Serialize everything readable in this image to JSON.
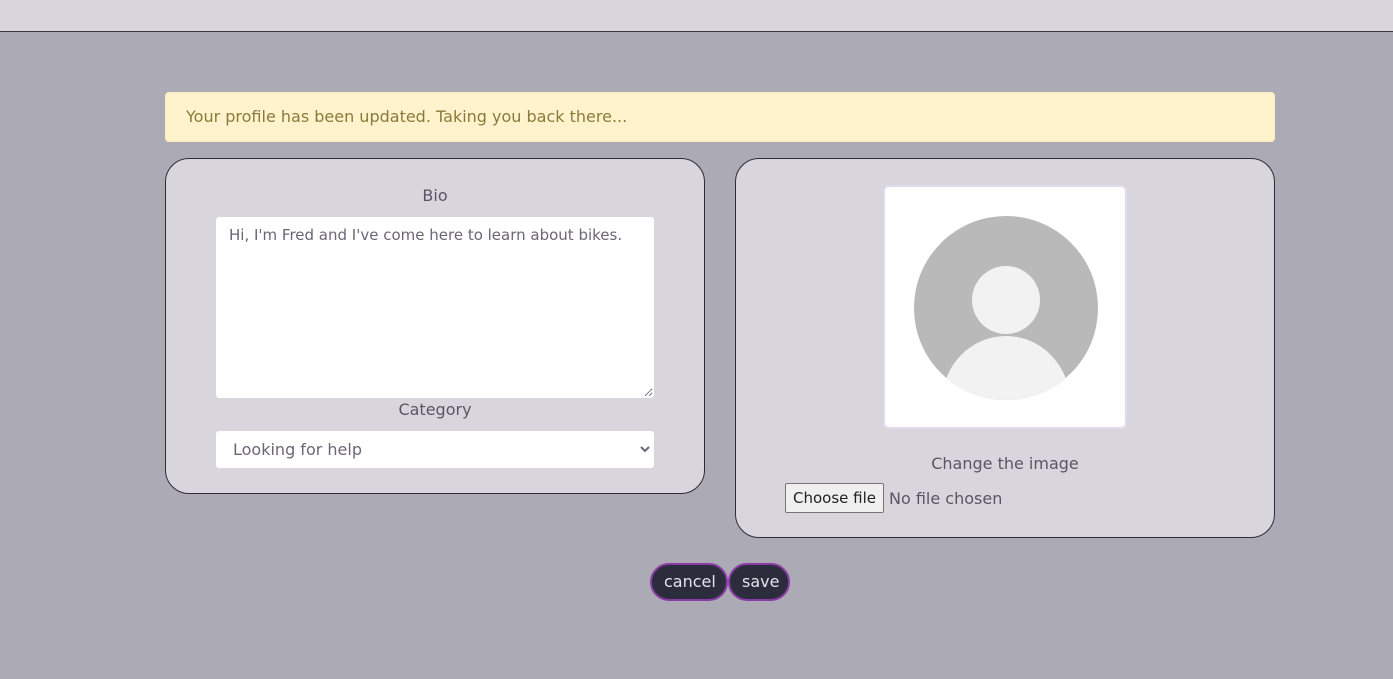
{
  "alert": {
    "message": "Your profile has been updated. Taking you back there..."
  },
  "profile_form": {
    "bio_label": "Bio",
    "bio_value": "Hi, I'm Fred and I've come here to learn about bikes.",
    "category_label": "Category",
    "category_selected": "Looking for help"
  },
  "image_panel": {
    "avatar_icon": "default-user-avatar-icon",
    "change_label": "Change the image",
    "file_button_label": "Choose file",
    "file_status": "No file chosen"
  },
  "actions": {
    "cancel_label": "cancel",
    "save_label": "save"
  },
  "colors": {
    "page_background": "#acaab5",
    "card_background": "#d8d6dc",
    "alert_background": "#fff3cd",
    "button_background": "#2b2d3c",
    "button_border": "#8a3aa6"
  }
}
